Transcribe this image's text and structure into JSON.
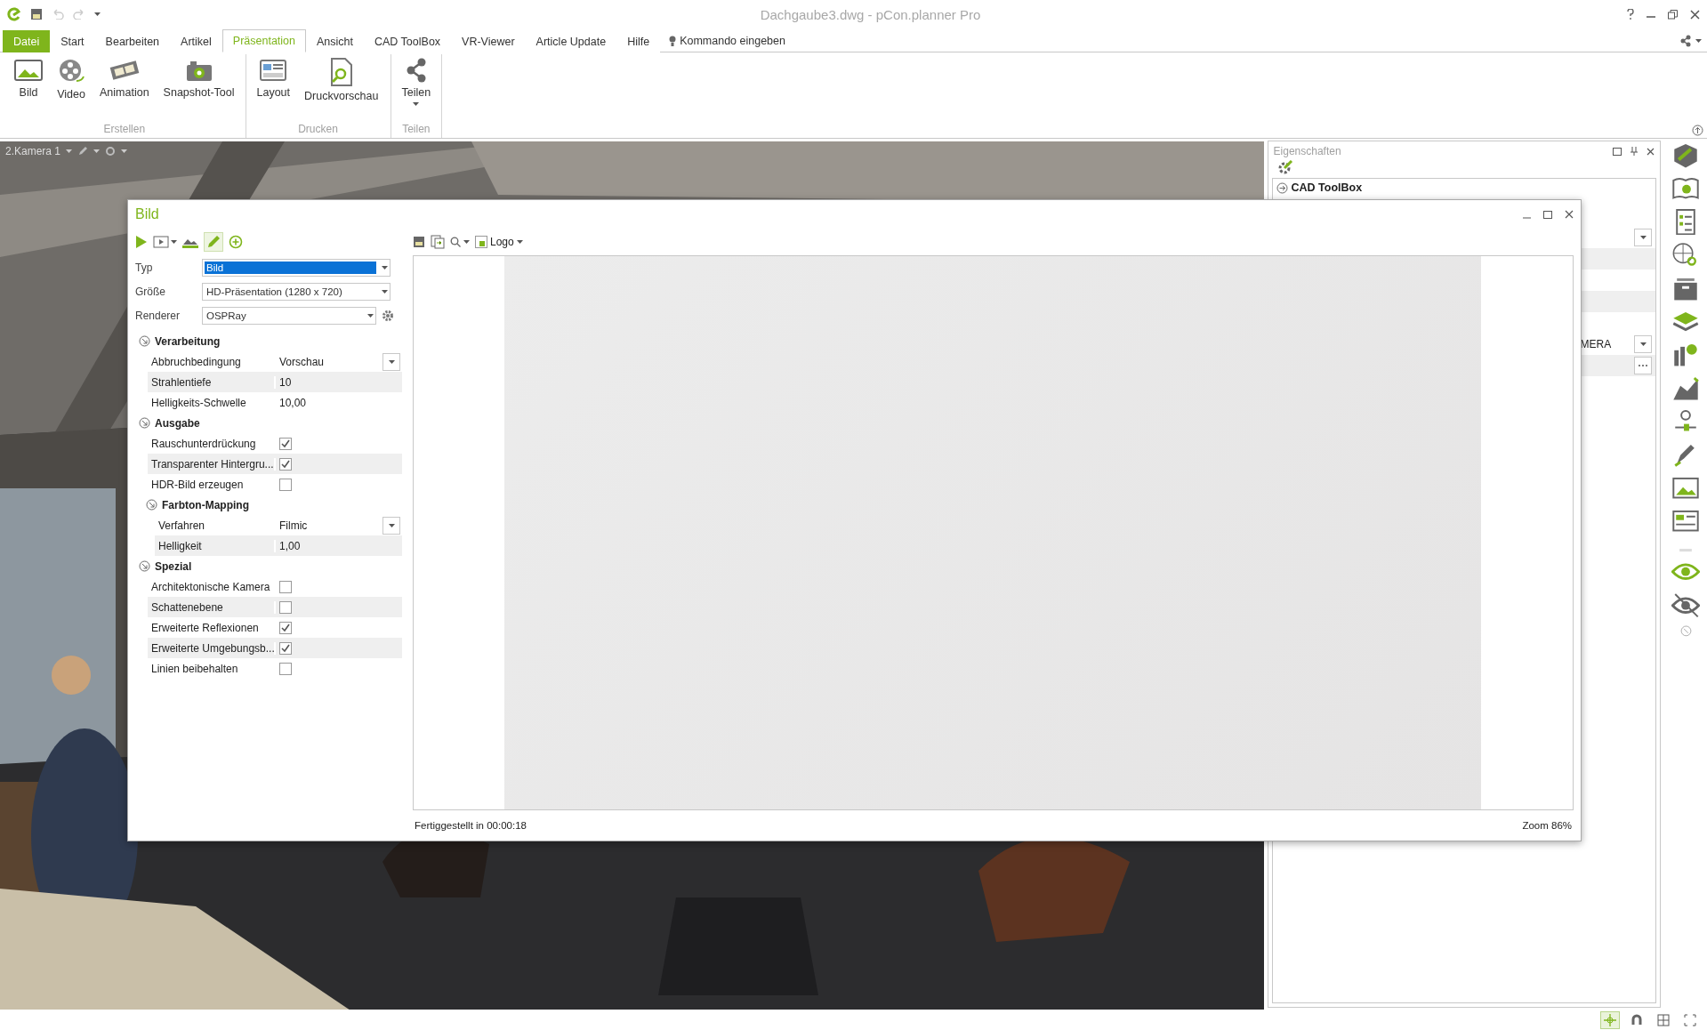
{
  "window": {
    "title": "Dachgaube3.dwg - pCon.planner Pro"
  },
  "menu_tabs": [
    {
      "label": "Datei",
      "kind": "file",
      "selected": false
    },
    {
      "label": "Start",
      "kind": "tab",
      "selected": false
    },
    {
      "label": "Bearbeiten",
      "kind": "tab",
      "selected": false
    },
    {
      "label": "Artikel",
      "kind": "tab",
      "selected": false
    },
    {
      "label": "Präsentation",
      "kind": "tab",
      "selected": true
    },
    {
      "label": "Ansicht",
      "kind": "tab",
      "selected": false
    },
    {
      "label": "CAD ToolBox",
      "kind": "tab",
      "selected": false
    },
    {
      "label": "VR-Viewer",
      "kind": "tab",
      "selected": false
    },
    {
      "label": "Article Update",
      "kind": "tab",
      "selected": false
    },
    {
      "label": "Hilfe",
      "kind": "tab",
      "selected": false
    }
  ],
  "command_search": {
    "label": "Kommando eingeben"
  },
  "ribbon": {
    "groups": [
      {
        "label": "Erstellen",
        "buttons": [
          {
            "label": "Bild"
          },
          {
            "label": "Video"
          },
          {
            "label": "Animation"
          },
          {
            "label": "Snapshot-Tool"
          }
        ]
      },
      {
        "label": "Drucken",
        "buttons": [
          {
            "label": "Layout"
          },
          {
            "label": "Druckvorschau"
          }
        ]
      },
      {
        "label": "Teilen",
        "buttons": [
          {
            "label": "Teilen"
          }
        ]
      }
    ]
  },
  "viewport": {
    "camera_label": "2.Kamera 1"
  },
  "properties_panel": {
    "title": "Eigenschaften",
    "section": "CAD ToolBox",
    "value_text": "MERA"
  },
  "dialog": {
    "title": "Bild",
    "fields": [
      {
        "label": "Typ",
        "value": "Bild",
        "selected": true,
        "settings": false
      },
      {
        "label": "Größe",
        "value": "HD-Präsentation (1280 x 720)",
        "selected": false,
        "settings": false
      },
      {
        "label": "Renderer",
        "value": "OSPRay",
        "selected": false,
        "settings": true
      }
    ],
    "sections": [
      {
        "title": "Verarbeitung",
        "rows": [
          {
            "label": "Abbruchbedingung",
            "kind": "dropdown",
            "value": "Vorschau"
          },
          {
            "label": "Strahlentiefe",
            "kind": "text",
            "value": "10"
          },
          {
            "label": "Helligkeits-Schwelle",
            "kind": "text",
            "value": "10,00"
          }
        ]
      },
      {
        "title": "Ausgabe",
        "rows": [
          {
            "label": "Rauschunterdrückung",
            "kind": "checkbox",
            "checked": true
          },
          {
            "label": "Transparenter Hintergru...",
            "kind": "checkbox",
            "checked": true
          },
          {
            "label": "HDR-Bild erzeugen",
            "kind": "checkbox",
            "checked": false
          }
        ],
        "children": [
          {
            "title": "Farbton-Mapping",
            "rows": [
              {
                "label": "Verfahren",
                "kind": "dropdown",
                "value": "Filmic"
              },
              {
                "label": "Helligkeit",
                "kind": "text",
                "value": "1,00"
              }
            ]
          }
        ]
      },
      {
        "title": "Spezial",
        "rows": [
          {
            "label": "Architektonische Kamera",
            "kind": "checkbox",
            "checked": false
          },
          {
            "label": "Schattenebene",
            "kind": "checkbox",
            "checked": false
          },
          {
            "label": "Erweiterte Reflexionen",
            "kind": "checkbox",
            "checked": true
          },
          {
            "label": "Erweiterte Umgebungsb...",
            "kind": "checkbox",
            "checked": true
          },
          {
            "label": "Linien beibehalten",
            "kind": "checkbox",
            "checked": false
          }
        ]
      }
    ],
    "preview_toolbar": {
      "logo_label": "Logo"
    },
    "status": "Fertiggestellt in 00:00:18",
    "zoom": "Zoom 86%"
  },
  "status_tools": [
    {
      "kind": "move",
      "selected": true
    },
    {
      "kind": "magnet",
      "selected": false
    },
    {
      "kind": "grid",
      "selected": false
    },
    {
      "kind": "fullscreen",
      "selected": false
    }
  ]
}
